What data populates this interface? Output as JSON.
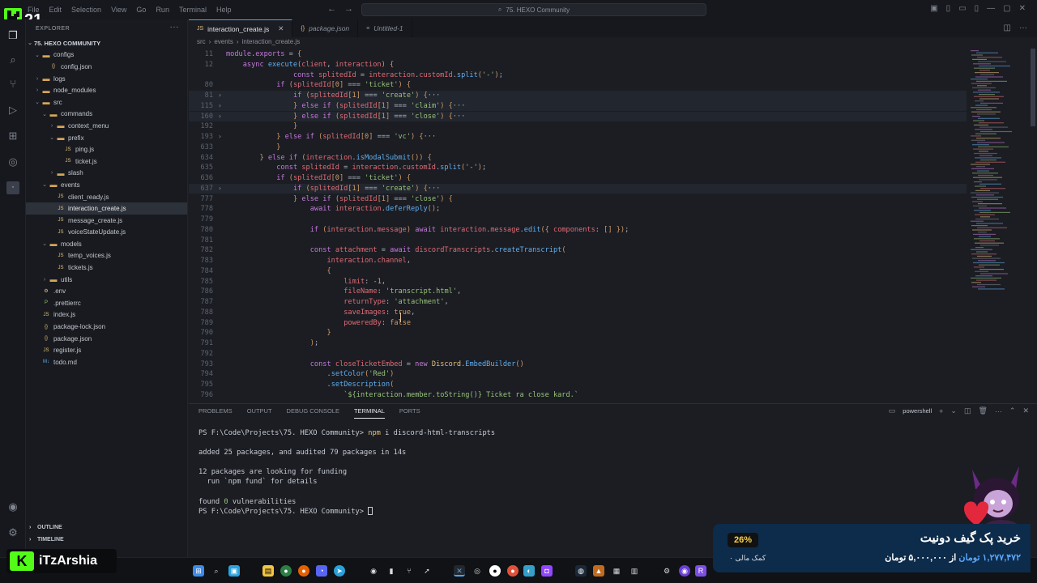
{
  "titlebar": {
    "menu": [
      "File",
      "Edit",
      "Selection",
      "View",
      "Go",
      "Run",
      "Terminal",
      "Help"
    ],
    "search": "75. HEXO Community"
  },
  "overlay_logo": {
    "text": "21"
  },
  "explorer": {
    "title": "EXPLORER",
    "root": "75. HEXO COMMUNITY",
    "items": [
      {
        "label": "configs",
        "type": "folder",
        "depth": 1,
        "open": true
      },
      {
        "label": "config.json",
        "type": "json",
        "depth": 2
      },
      {
        "label": "logs",
        "type": "folder",
        "depth": 1,
        "open": false
      },
      {
        "label": "node_modules",
        "type": "folder",
        "depth": 1,
        "open": false
      },
      {
        "label": "src",
        "type": "folder",
        "depth": 1,
        "open": true
      },
      {
        "label": "commands",
        "type": "folder",
        "depth": 2,
        "open": true
      },
      {
        "label": "context_menu",
        "type": "folder",
        "depth": 3,
        "open": false
      },
      {
        "label": "prefix",
        "type": "folder",
        "depth": 3,
        "open": true
      },
      {
        "label": "ping.js",
        "type": "js",
        "depth": 4
      },
      {
        "label": "ticket.js",
        "type": "js",
        "depth": 4
      },
      {
        "label": "slash",
        "type": "folder",
        "depth": 3,
        "open": false
      },
      {
        "label": "events",
        "type": "folder",
        "depth": 2,
        "open": true
      },
      {
        "label": "client_ready.js",
        "type": "js",
        "depth": 3
      },
      {
        "label": "interaction_create.js",
        "type": "js",
        "depth": 3,
        "selected": true
      },
      {
        "label": "message_create.js",
        "type": "js",
        "depth": 3
      },
      {
        "label": "voiceStateUpdate.js",
        "type": "js",
        "depth": 3
      },
      {
        "label": "models",
        "type": "folder",
        "depth": 2,
        "open": true
      },
      {
        "label": "temp_voices.js",
        "type": "js",
        "depth": 3
      },
      {
        "label": "tickets.js",
        "type": "js",
        "depth": 3
      },
      {
        "label": "utils",
        "type": "folder",
        "depth": 2,
        "open": false
      },
      {
        "label": ".env",
        "type": "env",
        "depth": 1
      },
      {
        "label": ".prettierrc",
        "type": "cfg",
        "depth": 1
      },
      {
        "label": "index.js",
        "type": "js",
        "depth": 1
      },
      {
        "label": "package-lock.json",
        "type": "json",
        "depth": 1
      },
      {
        "label": "package.json",
        "type": "json",
        "depth": 1
      },
      {
        "label": "register.js",
        "type": "js",
        "depth": 1
      },
      {
        "label": "todo.md",
        "type": "md",
        "depth": 1
      }
    ],
    "outline": "OUTLINE",
    "timeline": "TIMELINE"
  },
  "tabs": [
    {
      "label": "interaction_create.js",
      "active": true
    },
    {
      "label": "package.json",
      "active": false
    },
    {
      "label": "Untitled-1",
      "active": false
    }
  ],
  "breadcrumb": [
    "src",
    "events",
    "interaction_create.js"
  ],
  "code_lines": [
    {
      "n": "11",
      "fold": "",
      "t": "module.exports = {"
    },
    {
      "n": "12",
      "fold": "",
      "t": "    async execute(client, interaction) {"
    },
    {
      "n": "",
      "fold": "",
      "t": "                const splitedId = interaction.customId.split('-');"
    },
    {
      "n": "80",
      "fold": "",
      "t": "            if (splitedId[0] === 'ticket') {"
    },
    {
      "n": "81",
      "fold": "›",
      "t": "                if (splitedId[1] === 'create') {···"
    },
    {
      "n": "115",
      "fold": "›",
      "t": "                } else if (splitedId[1] === 'claim') {···"
    },
    {
      "n": "160",
      "fold": "›",
      "t": "                } else if (splitedId[1] === 'close') {···"
    },
    {
      "n": "192",
      "fold": "",
      "t": "                }"
    },
    {
      "n": "193",
      "fold": "›",
      "t": "            } else if (splitedId[0] === 'vc') {···"
    },
    {
      "n": "633",
      "fold": "",
      "t": "            }"
    },
    {
      "n": "634",
      "fold": "",
      "t": "        } else if (interaction.isModalSubmit()) {"
    },
    {
      "n": "635",
      "fold": "",
      "t": "            const splitedId = interaction.customId.split('-');"
    },
    {
      "n": "636",
      "fold": "",
      "t": "            if (splitedId[0] === 'ticket') {"
    },
    {
      "n": "637",
      "fold": "›",
      "t": "                if (splitedId[1] === 'create') {···"
    },
    {
      "n": "777",
      "fold": "",
      "t": "                } else if (splitedId[1] === 'close') {"
    },
    {
      "n": "778",
      "fold": "",
      "t": "                    await interaction.deferReply();"
    },
    {
      "n": "779",
      "fold": "",
      "t": ""
    },
    {
      "n": "780",
      "fold": "",
      "t": "                    if (interaction.message) await interaction.message.edit({ components: [] });"
    },
    {
      "n": "781",
      "fold": "",
      "t": ""
    },
    {
      "n": "782",
      "fold": "",
      "t": "                    const attachment = await discordTranscripts.createTranscript("
    },
    {
      "n": "783",
      "fold": "",
      "t": "                        interaction.channel,"
    },
    {
      "n": "784",
      "fold": "",
      "t": "                        {"
    },
    {
      "n": "785",
      "fold": "",
      "t": "                            limit: -1,"
    },
    {
      "n": "786",
      "fold": "",
      "t": "                            fileName: 'transcript.html',"
    },
    {
      "n": "787",
      "fold": "",
      "t": "                            returnType: 'attachment',"
    },
    {
      "n": "788",
      "fold": "",
      "t": "                            saveImages: true,"
    },
    {
      "n": "789",
      "fold": "",
      "t": "                            poweredBy: false"
    },
    {
      "n": "790",
      "fold": "",
      "t": "                        }"
    },
    {
      "n": "791",
      "fold": "",
      "t": "                    );"
    },
    {
      "n": "792",
      "fold": "",
      "t": ""
    },
    {
      "n": "793",
      "fold": "",
      "t": "                    const closeTicketEmbed = new Discord.EmbedBuilder()"
    },
    {
      "n": "794",
      "fold": "",
      "t": "                        .setColor('Red')"
    },
    {
      "n": "795",
      "fold": "",
      "t": "                        .setDescription("
    },
    {
      "n": "796",
      "fold": "",
      "t": "                            `${interaction.member.toString()} Ticket ra close kard.`"
    },
    {
      "n": "797",
      "fold": "",
      "t": "                        );"
    }
  ],
  "panel": {
    "tabs": [
      "PROBLEMS",
      "OUTPUT",
      "DEBUG CONSOLE",
      "TERMINAL",
      "PORTS"
    ],
    "active": "TERMINAL",
    "shell": "powershell",
    "prompt": "PS F:\\Code\\Projects\\75. HEXO Community>",
    "cmd_bin": "npm",
    "cmd_arg": "i discord-html-transcripts",
    "out1": "added 25 packages, and audited 79 packages in 14s",
    "out2": "12 packages are looking for funding",
    "out3": "  run `npm fund` for details",
    "out4a": "found ",
    "out4b": "0",
    "out4c": " vulnerabilities"
  },
  "brand": {
    "name": "iTzArshia",
    "letter": "K"
  },
  "donation": {
    "percent": "26%",
    "title": "خرید پک گیف دونیت",
    "amount_current": "۱,۲۷۷,۴۷۲ تومان",
    "amount_target": "از ۵,۰۰۰,۰۰۰ تومان",
    "subtitle": "۰ کمک مالی"
  }
}
